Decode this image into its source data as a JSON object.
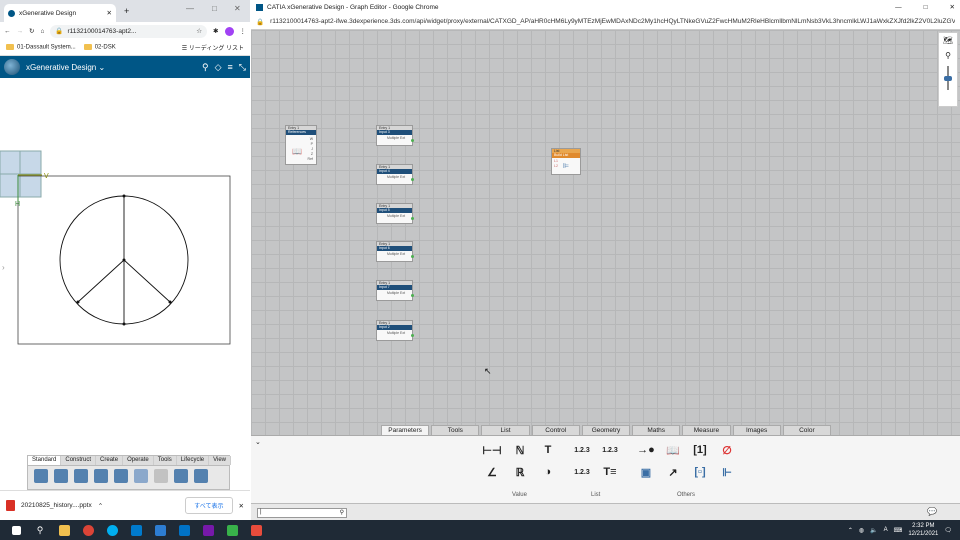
{
  "left_window": {
    "tab_title": "xGenerative Design",
    "url": "r1132100014763-apt2...",
    "bookmarks": [
      "01-Dassault System...",
      "02-DSK"
    ],
    "reading_list": "リーディング リスト",
    "app_title": "xGenerative Design",
    "command_tabs": [
      "Standard",
      "Construct",
      "Create",
      "Operate",
      "Tools",
      "Lifecycle",
      "View"
    ],
    "download_file": "20210825_history....pptx",
    "show_all": "すべて表示",
    "axis_labels": {
      "v": "V",
      "h": "H"
    }
  },
  "right_window": {
    "window_title": "CATIA xGenerative Design - Graph Editor - Google Chrome",
    "url": "r1132100014763-apt2-ifwe.3dexperience.3ds.com/api/widget/proxy/external/CATXGD_AP/aHR0cHM6Ly9yMTEzMjEwMDAxNDc2My1hcHQyLTNkeGVuZ2FwcHMuM2RleHBlcmllbmNlLmNsb3VkL3hncmlkLWJ1aWxkZXJfd2lkZ2V0L2luZGV4Lmh0bWw...",
    "nodes": [
      {
        "type": "Entry 1",
        "title": "References",
        "ports": [
          "W",
          "P",
          "J",
          "Z",
          "Ref"
        ]
      },
      {
        "type": "Entry 1",
        "title": "Input 3",
        "body": "Multiple Ext"
      },
      {
        "type": "Entry 1",
        "title": "Input 4",
        "body": "Multiple Ext"
      },
      {
        "type": "Entry 1",
        "title": "Input 5",
        "body": "Multiple Ext"
      },
      {
        "type": "Entry 1",
        "title": "Input 6",
        "body": "Multiple Ext"
      },
      {
        "type": "Entry 1",
        "title": "Input 7",
        "body": "Multiple Ext"
      },
      {
        "type": "Entry 1",
        "title": "Input 2",
        "body": "Multiple Ext"
      },
      {
        "type": "List",
        "title": "Build List",
        "ports": [
          "L1",
          "L2"
        ]
      }
    ],
    "palette_tabs": [
      "Parameters",
      "Tools",
      "List",
      "Control",
      "Geometry",
      "Maths",
      "Measure",
      "Images",
      "Color"
    ],
    "active_palette_tab": "Parameters",
    "palette_groups": [
      "Value",
      "List",
      "Others"
    ],
    "search_placeholder": "|"
  },
  "taskbar": {
    "time": "2:32 PM",
    "date": "12/21/2021",
    "lang": "A"
  }
}
